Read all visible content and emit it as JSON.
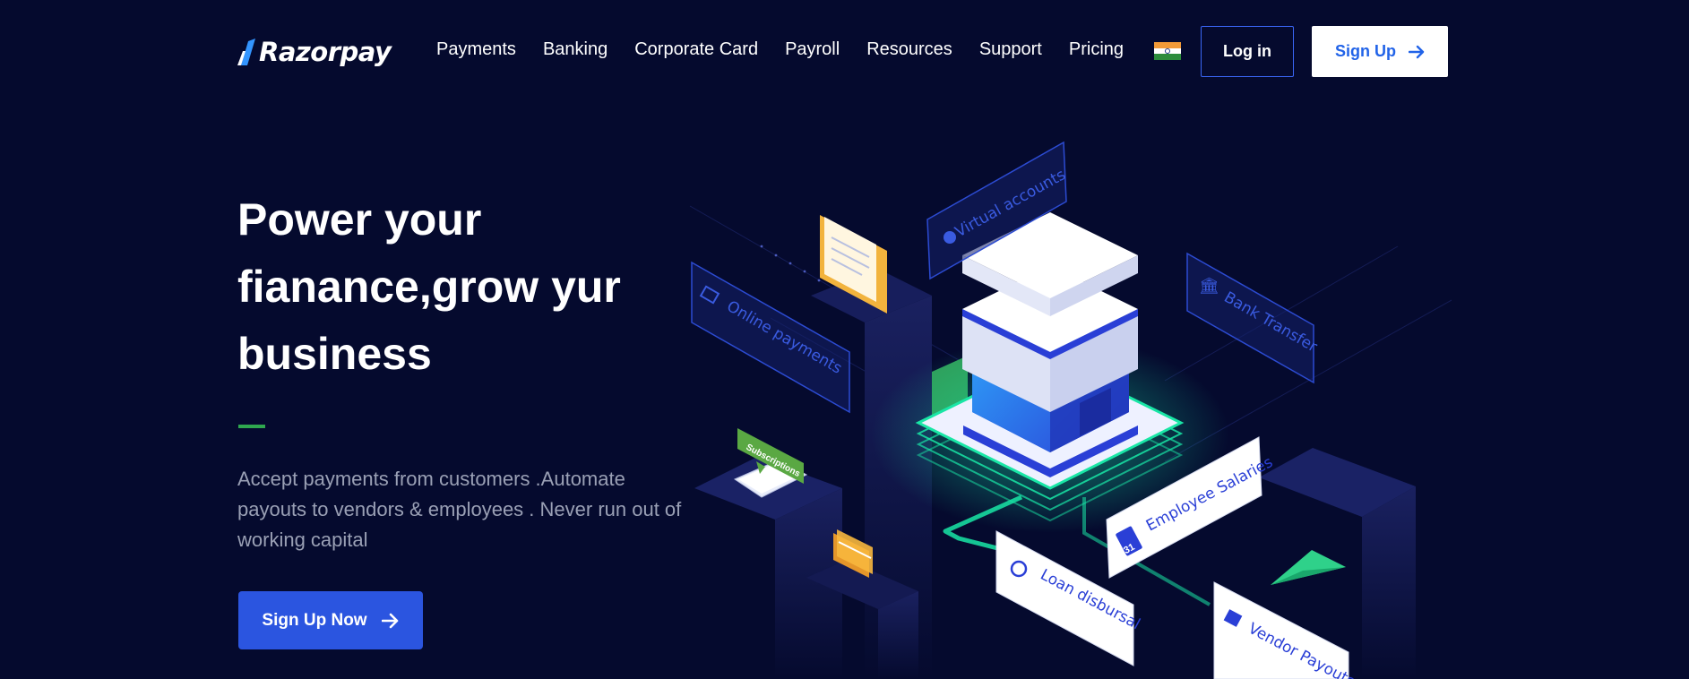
{
  "brand": {
    "name": "Razorpay"
  },
  "nav": {
    "links": [
      "Payments",
      "Banking",
      "Corporate Card",
      "Payroll",
      "Resources",
      "Support",
      "Pricing"
    ],
    "login_label": "Log in",
    "signup_label": "Sign Up",
    "flag_icon": "india-flag-icon"
  },
  "hero": {
    "title_lines": [
      "Power your",
      "fianance,grow yur",
      "business"
    ],
    "subtitle": "Accept payments from customers .Automate payouts to vendors & employees . Never run out of working capital",
    "cta_label": "Sign Up Now"
  },
  "illustration": {
    "labels": {
      "virtual_accounts": "Virtual accounts",
      "bank_transfer": "Bank Transfer",
      "online_payments": "Online payments",
      "subscriptions": "Subscriptions",
      "employee_salaries": "Employee Salaries",
      "loan_disbursal": "Loan disbursal",
      "vendor_payouts": "Vendor Payouts",
      "calendar_day": "31"
    }
  },
  "colors": {
    "background": "#050a2e",
    "primary_blue": "#2b55e0",
    "accent_green": "#2fa84f",
    "glow_green": "#19e6a6",
    "subtitle_gray": "#9aa0b5"
  }
}
